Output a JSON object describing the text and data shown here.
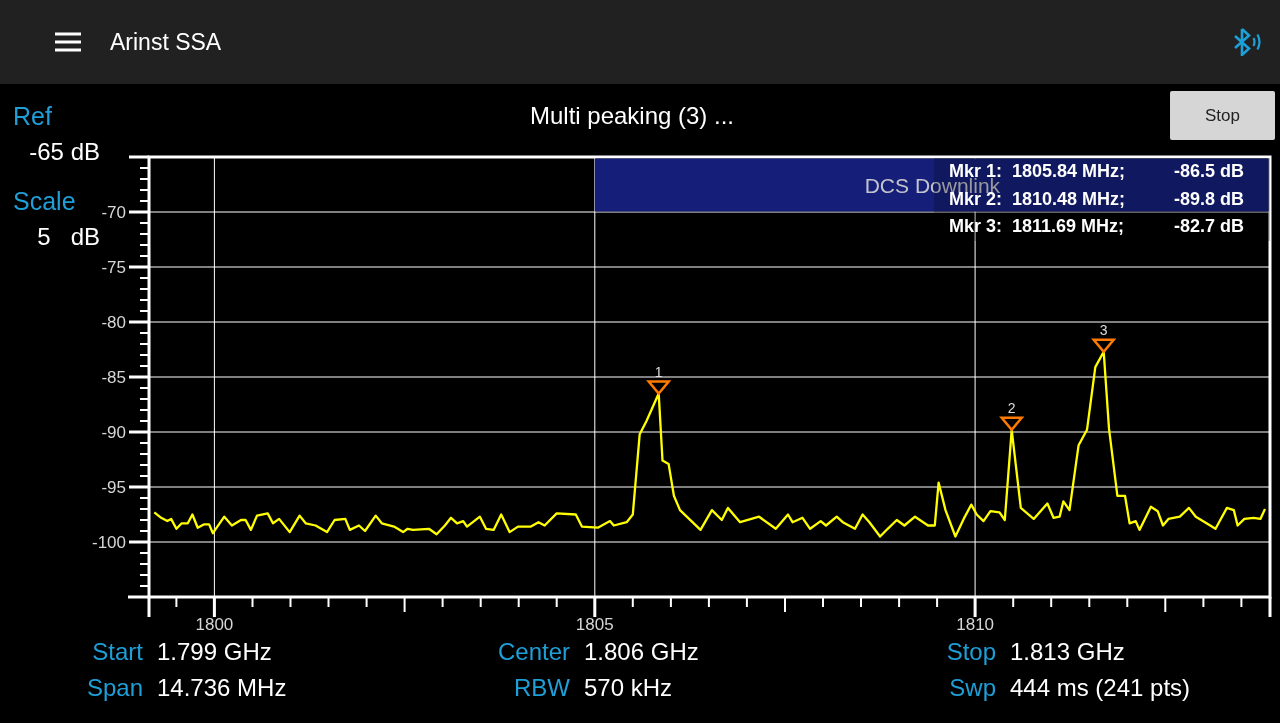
{
  "app_bar": {
    "title": "Arinst SSA"
  },
  "readouts": [
    {
      "label": "Ref",
      "value": "-65 dB"
    },
    {
      "label": "Scale",
      "value": "5   dB"
    }
  ],
  "status": "Multi peaking (3) ...",
  "stop_button": {
    "label": "Stop"
  },
  "spectrum": {
    "chart_data": {
      "type": "line",
      "grid": true,
      "xlim": [
        1799.14,
        1813.876
      ],
      "ylim": [
        -105,
        -65
      ],
      "xticks": [
        1800,
        1805,
        1810
      ],
      "yticks": [
        -70,
        -75,
        -80,
        -85,
        -90,
        -95,
        -100
      ],
      "x": [
        1799.21,
        1799.3,
        1799.38,
        1799.43,
        1799.5,
        1799.57,
        1799.65,
        1799.71,
        1799.78,
        1799.86,
        1799.93,
        1799.98,
        1800.13,
        1800.23,
        1800.35,
        1800.41,
        1800.48,
        1800.56,
        1800.7,
        1800.77,
        1800.85,
        1800.99,
        1801.12,
        1801.2,
        1801.33,
        1801.48,
        1801.58,
        1801.72,
        1801.78,
        1801.9,
        1801.98,
        1802.12,
        1802.2,
        1802.36,
        1802.48,
        1802.54,
        1802.61,
        1802.82,
        1802.92,
        1803.03,
        1803.11,
        1803.19,
        1803.27,
        1803.32,
        1803.49,
        1803.57,
        1803.67,
        1803.77,
        1803.88,
        1803.99,
        1804.16,
        1804.26,
        1804.34,
        1804.5,
        1804.75,
        1804.83,
        1805.04,
        1805.2,
        1805.25,
        1805.42,
        1805.5,
        1805.59,
        1805.68,
        1805.84,
        1805.89,
        1805.97,
        1806.04,
        1806.12,
        1806.39,
        1806.54,
        1806.67,
        1806.75,
        1806.91,
        1807.16,
        1807.38,
        1807.54,
        1807.6,
        1807.73,
        1807.83,
        1807.97,
        1808.04,
        1808.18,
        1808.26,
        1808.42,
        1808.52,
        1808.61,
        1808.75,
        1808.85,
        1808.97,
        1809.07,
        1809.21,
        1809.38,
        1809.47,
        1809.52,
        1809.61,
        1809.74,
        1809.85,
        1809.95,
        1810.02,
        1810.11,
        1810.2,
        1810.32,
        1810.39,
        1810.48,
        1810.6,
        1810.77,
        1810.95,
        1811.03,
        1811.11,
        1811.16,
        1811.24,
        1811.36,
        1811.47,
        1811.58,
        1811.69,
        1811.76,
        1811.87,
        1811.97,
        1812.03,
        1812.11,
        1812.16,
        1812.31,
        1812.4,
        1812.47,
        1812.54,
        1812.69,
        1812.81,
        1812.9,
        1813.02,
        1813.16,
        1813.31,
        1813.4,
        1813.45,
        1813.54,
        1813.66,
        1813.75,
        1813.81
      ],
      "values": [
        -97.3,
        -97.8,
        -98.1,
        -97.9,
        -98.8,
        -98.3,
        -98.3,
        -97.5,
        -98.7,
        -98.4,
        -98.4,
        -99.2,
        -97.7,
        -98.5,
        -98.0,
        -98.0,
        -98.9,
        -97.6,
        -97.4,
        -98.3,
        -97.9,
        -99.1,
        -97.6,
        -98.3,
        -98.5,
        -99.1,
        -98.0,
        -97.9,
        -98.9,
        -98.5,
        -99.0,
        -97.6,
        -98.3,
        -98.6,
        -99.1,
        -98.8,
        -98.9,
        -98.8,
        -99.3,
        -98.5,
        -97.8,
        -98.3,
        -98.1,
        -98.6,
        -97.7,
        -98.8,
        -98.9,
        -97.5,
        -99.1,
        -98.6,
        -98.6,
        -98.2,
        -98.5,
        -97.4,
        -97.5,
        -98.6,
        -98.7,
        -98.1,
        -98.5,
        -98.2,
        -97.5,
        -90.2,
        -89.0,
        -86.5,
        -92.6,
        -92.9,
        -95.8,
        -97.1,
        -98.9,
        -97.1,
        -98.0,
        -96.9,
        -98.2,
        -97.7,
        -98.8,
        -97.5,
        -98.2,
        -97.8,
        -98.8,
        -98.1,
        -98.5,
        -97.7,
        -98.2,
        -98.8,
        -97.5,
        -98.2,
        -99.5,
        -98.8,
        -98.0,
        -98.5,
        -97.7,
        -98.5,
        -98.5,
        -94.6,
        -97.1,
        -99.5,
        -97.9,
        -96.6,
        -97.5,
        -98.1,
        -97.2,
        -97.3,
        -98.0,
        -89.8,
        -96.9,
        -97.9,
        -96.5,
        -97.8,
        -97.7,
        -96.3,
        -97.1,
        -91.2,
        -89.8,
        -84.1,
        -82.7,
        -89.7,
        -95.8,
        -95.8,
        -98.3,
        -98.1,
        -98.9,
        -96.8,
        -97.2,
        -98.5,
        -97.9,
        -97.7,
        -96.9,
        -97.7,
        -98.2,
        -98.8,
        -96.9,
        -97.1,
        -98.5,
        -97.9,
        -97.8,
        -97.9,
        -97.0
      ],
      "bands": [
        {
          "axis": "x",
          "from": 1805,
          "to": 1813.876,
          "label": "DCS Downlink"
        }
      ],
      "annotations": [
        {
          "text": "1",
          "x": 1805.84,
          "y": -86.5
        },
        {
          "text": "2",
          "x": 1810.48,
          "y": -89.8
        },
        {
          "text": "3",
          "x": 1811.69,
          "y": -82.7
        }
      ]
    }
  },
  "marker_readout": [
    {
      "label": "Mkr 1:",
      "frequency": "1805.84 MHz;",
      "level": "-86.5 dB"
    },
    {
      "label": "Mkr 2:",
      "frequency": "1810.48 MHz;",
      "level": "-89.8 dB"
    },
    {
      "label": "Mkr 3:",
      "frequency": "1811.69 MHz;",
      "level": "-82.7 dB"
    }
  ],
  "sweep_info": [
    [
      {
        "label": "Start",
        "value": "1.799 GHz"
      },
      {
        "label": "Center",
        "value": "1.806 GHz"
      },
      {
        "label": "Stop",
        "value": "1.813 GHz"
      }
    ],
    [
      {
        "label": "Span",
        "value": "14.736 MHz"
      },
      {
        "label": "RBW",
        "value": "570 kHz"
      },
      {
        "label": "Swp",
        "value": "444 ms (241 pts)"
      }
    ]
  ]
}
